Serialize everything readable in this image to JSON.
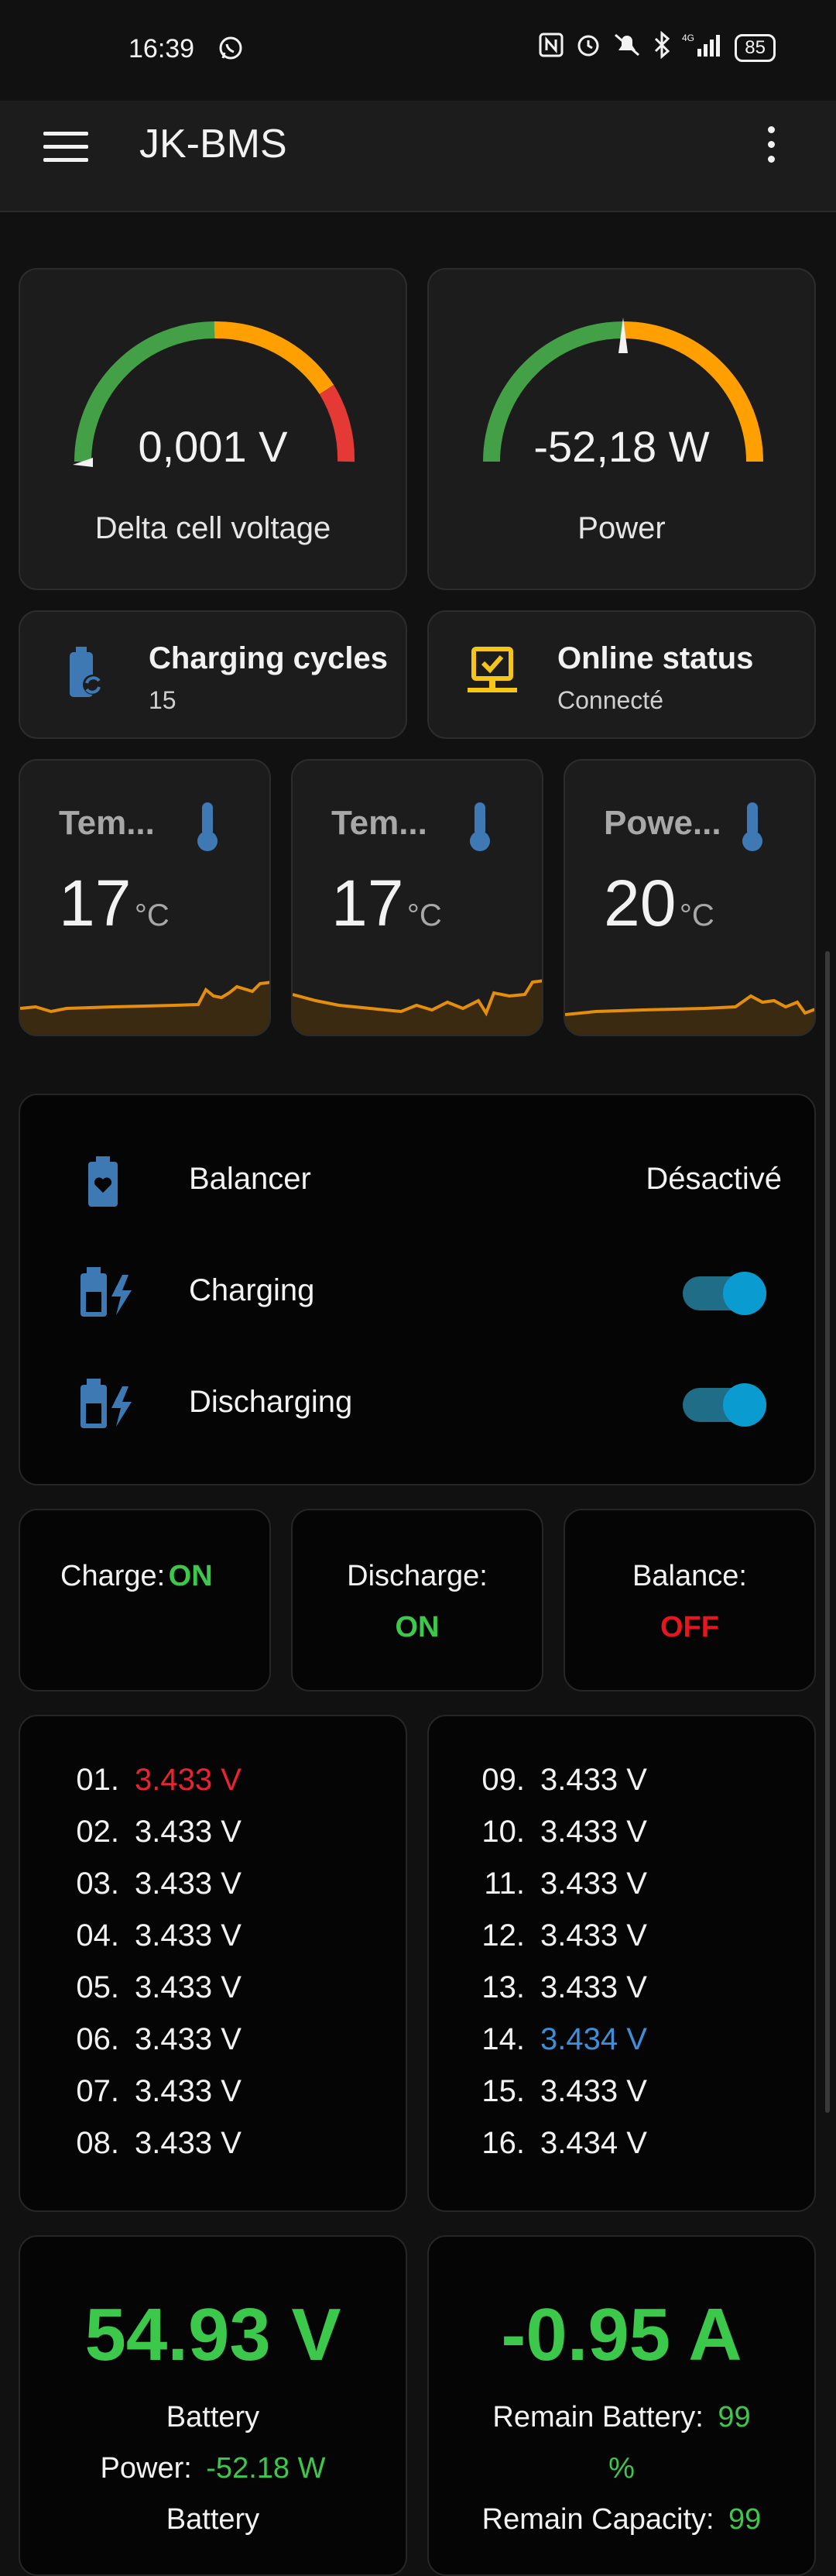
{
  "status_bar": {
    "time": "16:39",
    "battery": "85",
    "network": "4G"
  },
  "app": {
    "title": "JK-BMS"
  },
  "gauges": [
    {
      "value": "0,001 V",
      "label": "Delta cell voltage",
      "level": 0.0
    },
    {
      "value": "-52,18 W",
      "label": "Power",
      "level": 0.5
    }
  ],
  "tiles": [
    {
      "title": "Charging cycles",
      "value": "15",
      "icon": "battery-sync-icon"
    },
    {
      "title": "Online status",
      "value": "Connecté",
      "icon": "monitor-check-icon"
    }
  ],
  "temperatures": [
    {
      "name": "Tem...",
      "value": "17",
      "unit": "°C",
      "icon": "thermometer-icon"
    },
    {
      "name": "Tem...",
      "value": "17",
      "unit": "°C",
      "icon": "thermometer-icon"
    },
    {
      "name": "Powe...",
      "value": "20",
      "unit": "°C",
      "icon": "thermometer-icon"
    }
  ],
  "controls": [
    {
      "label": "Balancer",
      "state": "Désactivé",
      "icon": "battery-heart-icon"
    },
    {
      "label": "Charging",
      "on": true,
      "icon": "battery-charging-icon"
    },
    {
      "label": "Discharging",
      "on": true,
      "icon": "battery-charging-icon"
    }
  ],
  "states": [
    {
      "label": "Charge:",
      "value": "ON"
    },
    {
      "label": "Discharge:",
      "value": "ON"
    },
    {
      "label": "Balance:",
      "value": "OFF"
    }
  ],
  "cells": [
    {
      "idx": "01.",
      "value": "3.433 V",
      "color": "#e8242e"
    },
    {
      "idx": "02.",
      "value": "3.433 V",
      "color": "#f2f2f2"
    },
    {
      "idx": "03.",
      "value": "3.433 V",
      "color": "#f2f2f2"
    },
    {
      "idx": "04.",
      "value": "3.433 V",
      "color": "#f2f2f2"
    },
    {
      "idx": "05.",
      "value": "3.433 V",
      "color": "#f2f2f2"
    },
    {
      "idx": "06.",
      "value": "3.433 V",
      "color": "#f2f2f2"
    },
    {
      "idx": "07.",
      "value": "3.433 V",
      "color": "#f2f2f2"
    },
    {
      "idx": "08.",
      "value": "3.433 V",
      "color": "#f2f2f2"
    },
    {
      "idx": "09.",
      "value": "3.433 V",
      "color": "#f2f2f2"
    },
    {
      "idx": "10.",
      "value": "3.433 V",
      "color": "#f2f2f2"
    },
    {
      "idx": "11.",
      "value": "3.433 V",
      "color": "#f2f2f2"
    },
    {
      "idx": "12.",
      "value": "3.433 V",
      "color": "#f2f2f2"
    },
    {
      "idx": "13.",
      "value": "3.433 V",
      "color": "#f2f2f2"
    },
    {
      "idx": "14.",
      "value": "3.434 V",
      "color": "#3f8fd8"
    },
    {
      "idx": "15.",
      "value": "3.433 V",
      "color": "#f2f2f2"
    },
    {
      "idx": "16.",
      "value": "3.434 V",
      "color": "#f2f2f2"
    }
  ],
  "summary": {
    "voltage": "54.93 V",
    "current": "-0.95 A",
    "battery_label": "Battery",
    "power_label": "Power:",
    "power_value": "-52.18 W",
    "battery_label2": "Battery",
    "remain_battery_label": "Remain Battery:",
    "remain_battery_value": "99",
    "remain_battery_unit": "%",
    "remain_capacity_label": "Remain Capacity:",
    "remain_capacity_value": "99"
  },
  "colors": {
    "accent_blue": "#3f79b3",
    "ok_green": "#3cc84a",
    "error_red": "#e8141e",
    "gauge_green": "#43a047",
    "gauge_orange": "#ffa000",
    "gauge_red": "#e53935",
    "graph_orange": "#e58e0b"
  }
}
